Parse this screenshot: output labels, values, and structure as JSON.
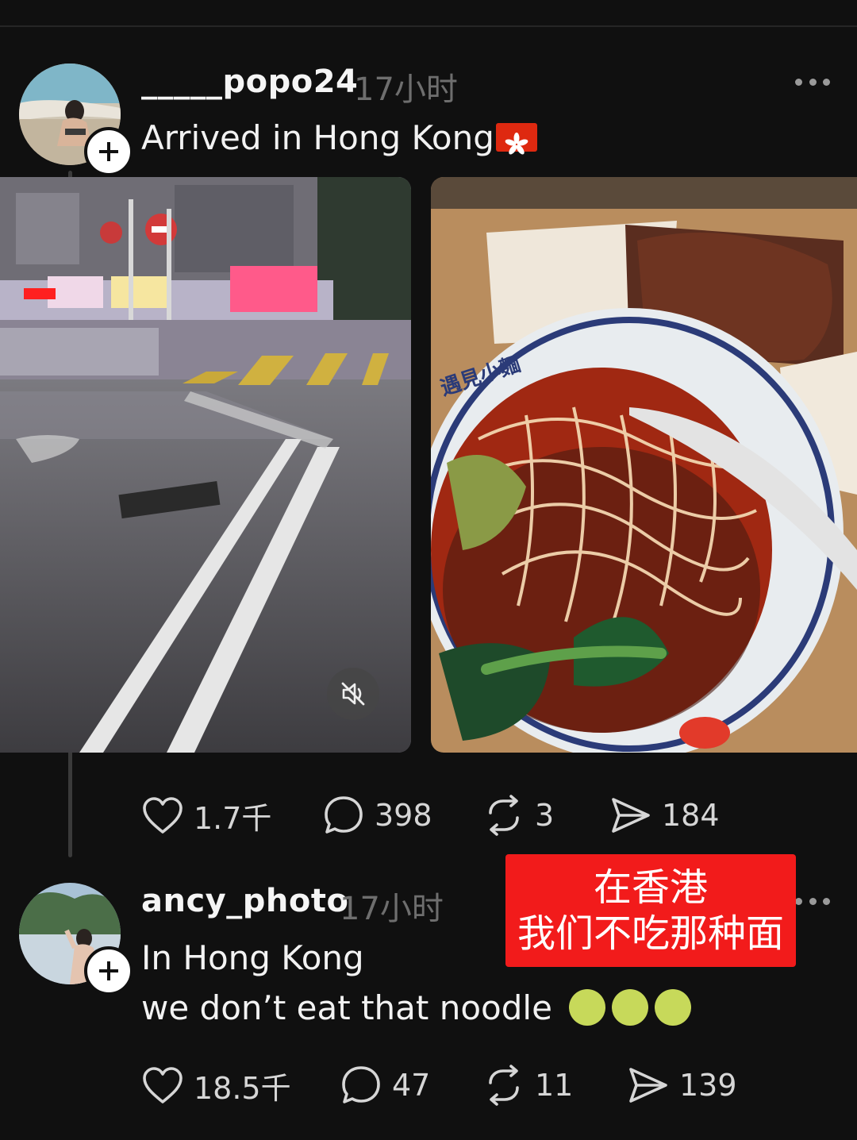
{
  "posts": [
    {
      "username": "_____popo24",
      "time": "17小时",
      "text": "Arrived in Hong Kong",
      "flag": "hong-kong-flag",
      "actions": {
        "likes": "1.7千",
        "comments": "398",
        "reposts": "3",
        "shares": "184"
      }
    },
    {
      "username": "ancy_photo",
      "time": "17小时",
      "text_line1": "In Hong Kong",
      "text_line2": "we don’t eat that noodle",
      "emoji": "nauseated-face",
      "actions": {
        "likes": "18.5千",
        "comments": "47",
        "reposts": "11",
        "shares": "139"
      }
    }
  ],
  "overlay": {
    "line1": "在香港",
    "line2": "我们不吃那种面"
  },
  "colors": {
    "background": "#101010",
    "banner_red": "#f21b1b",
    "muted_text": "#6e6e6e"
  }
}
